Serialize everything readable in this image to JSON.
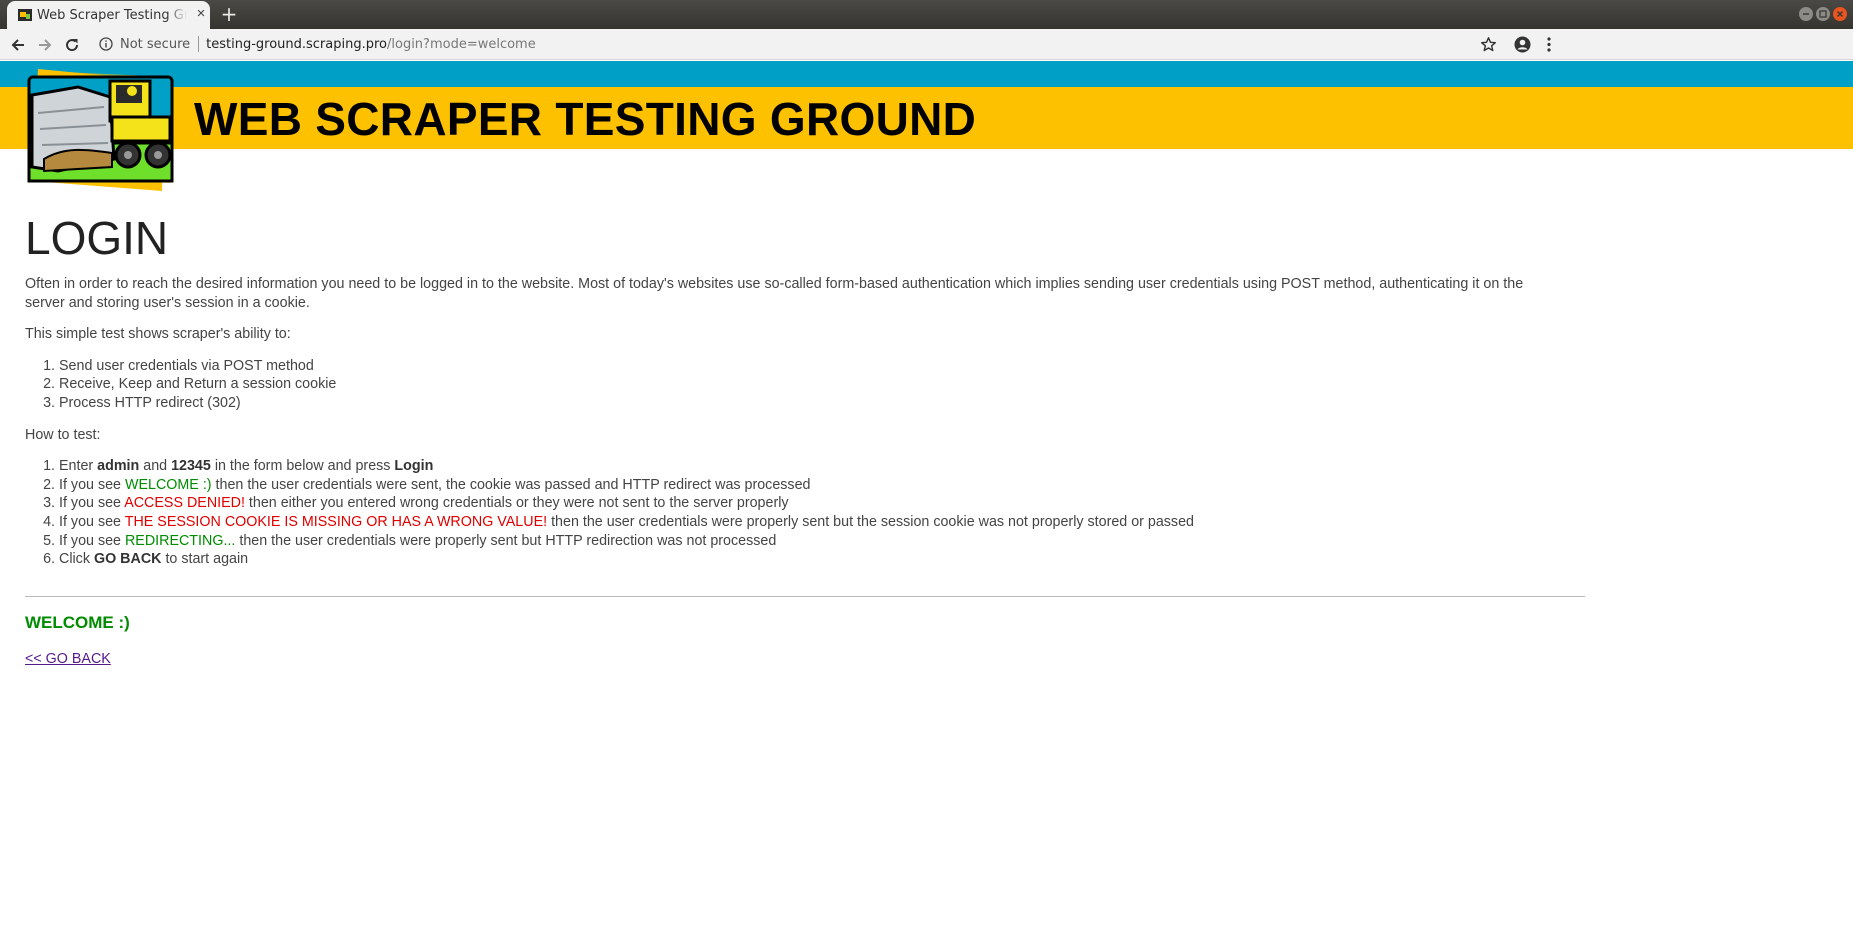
{
  "browser": {
    "tab_title": "Web Scraper Testing Ground",
    "security_label": "Not secure",
    "url_host": "testing-ground.scraping.pro",
    "url_path": "/login?mode=welcome"
  },
  "header": {
    "site_title": "WEB SCRAPER TESTING GROUND"
  },
  "main": {
    "heading": "LOGIN",
    "intro": "Often in order to reach the desired information you need to be logged in to the website. Most of today's websites use so-called form-based authentication which implies sending user credentials using POST method, authenticating it on the server and storing user's session in a cookie.",
    "ability_lead": "This simple test shows scraper's ability to:",
    "abilities": [
      "Send user credentials via POST method",
      "Receive, Keep and Return a session cookie",
      "Process HTTP redirect (302)"
    ],
    "howto_lead": "How to test:",
    "howto": {
      "step1": {
        "a": "Enter ",
        "b1": "admin",
        "c": " and ",
        "b2": "12345",
        "d": " in the form below and press ",
        "b3": "Login"
      },
      "step2": {
        "a": "If you see ",
        "hl": "WELCOME :)",
        "b": " then the user credentials were sent, the cookie was passed and HTTP redirect was processed"
      },
      "step3": {
        "a": "If you see ",
        "hl": "ACCESS DENIED!",
        "b": " then either you entered wrong credentials or they were not sent to the server properly"
      },
      "step4": {
        "a": "If you see ",
        "hl": "THE SESSION COOKIE IS MISSING OR HAS A WRONG VALUE!",
        "b": " then the user credentials were properly sent but the session cookie was not properly stored or passed"
      },
      "step5": {
        "a": "If you see ",
        "hl": "REDIRECTING...",
        "b": " then the user credentials were properly sent but HTTP redirection was not processed"
      },
      "step6": {
        "a": "Click ",
        "b1": "GO BACK",
        "c": " to start again"
      }
    },
    "result": "WELCOME :)",
    "go_back": "<< GO BACK"
  },
  "colors": {
    "band_blue": "#00a0c6",
    "band_yellow": "#fdc100",
    "success_green": "#008c00",
    "error_red": "#e00000",
    "link_visited": "#551a8b"
  }
}
